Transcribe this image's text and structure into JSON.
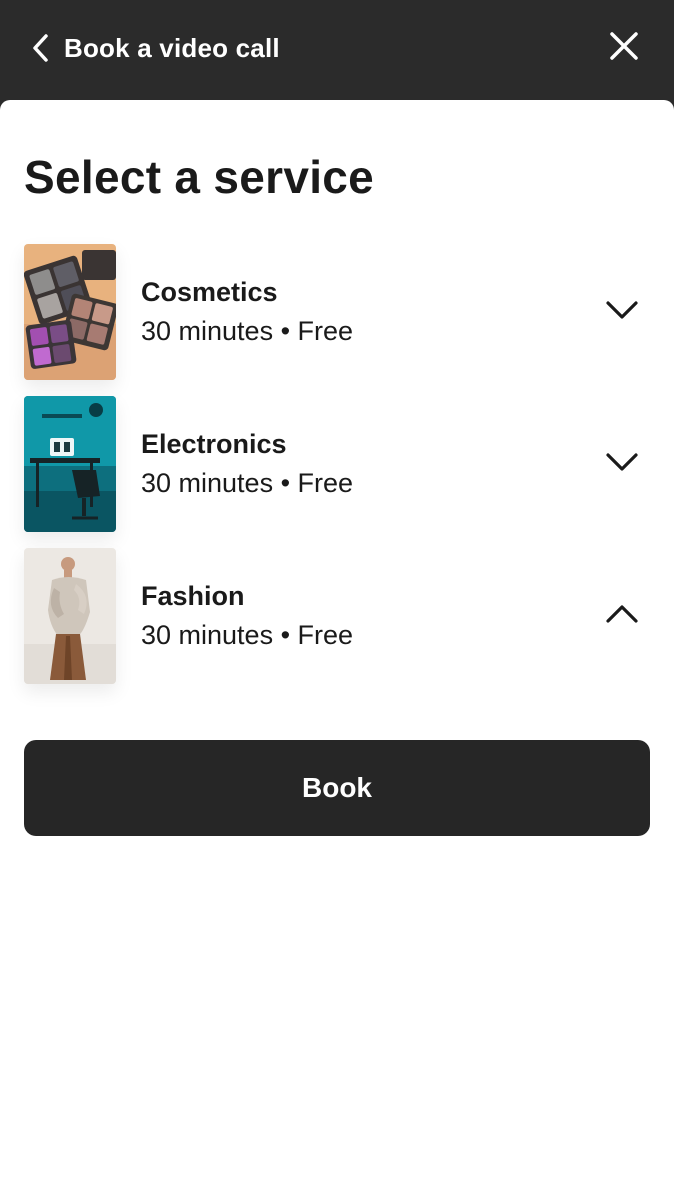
{
  "header": {
    "title": "Book a video call",
    "back_icon": "chevron-left-icon",
    "close_icon": "close-icon"
  },
  "page_title": "Select a service",
  "services": [
    {
      "name": "Cosmetics",
      "meta": "30 minutes • Free",
      "expanded": false,
      "chevron_icon": "chevron-down-icon"
    },
    {
      "name": "Electronics",
      "meta": "30 minutes • Free",
      "expanded": false,
      "chevron_icon": "chevron-down-icon"
    },
    {
      "name": "Fashion",
      "meta": "30 minutes • Free",
      "expanded": true,
      "chevron_icon": "chevron-up-icon"
    }
  ],
  "book_button": {
    "label": "Book"
  },
  "colors": {
    "header_bg": "#2b2b2b",
    "button_bg": "#262626",
    "text": "#1a1a1a",
    "sheet_bg": "#ffffff"
  }
}
